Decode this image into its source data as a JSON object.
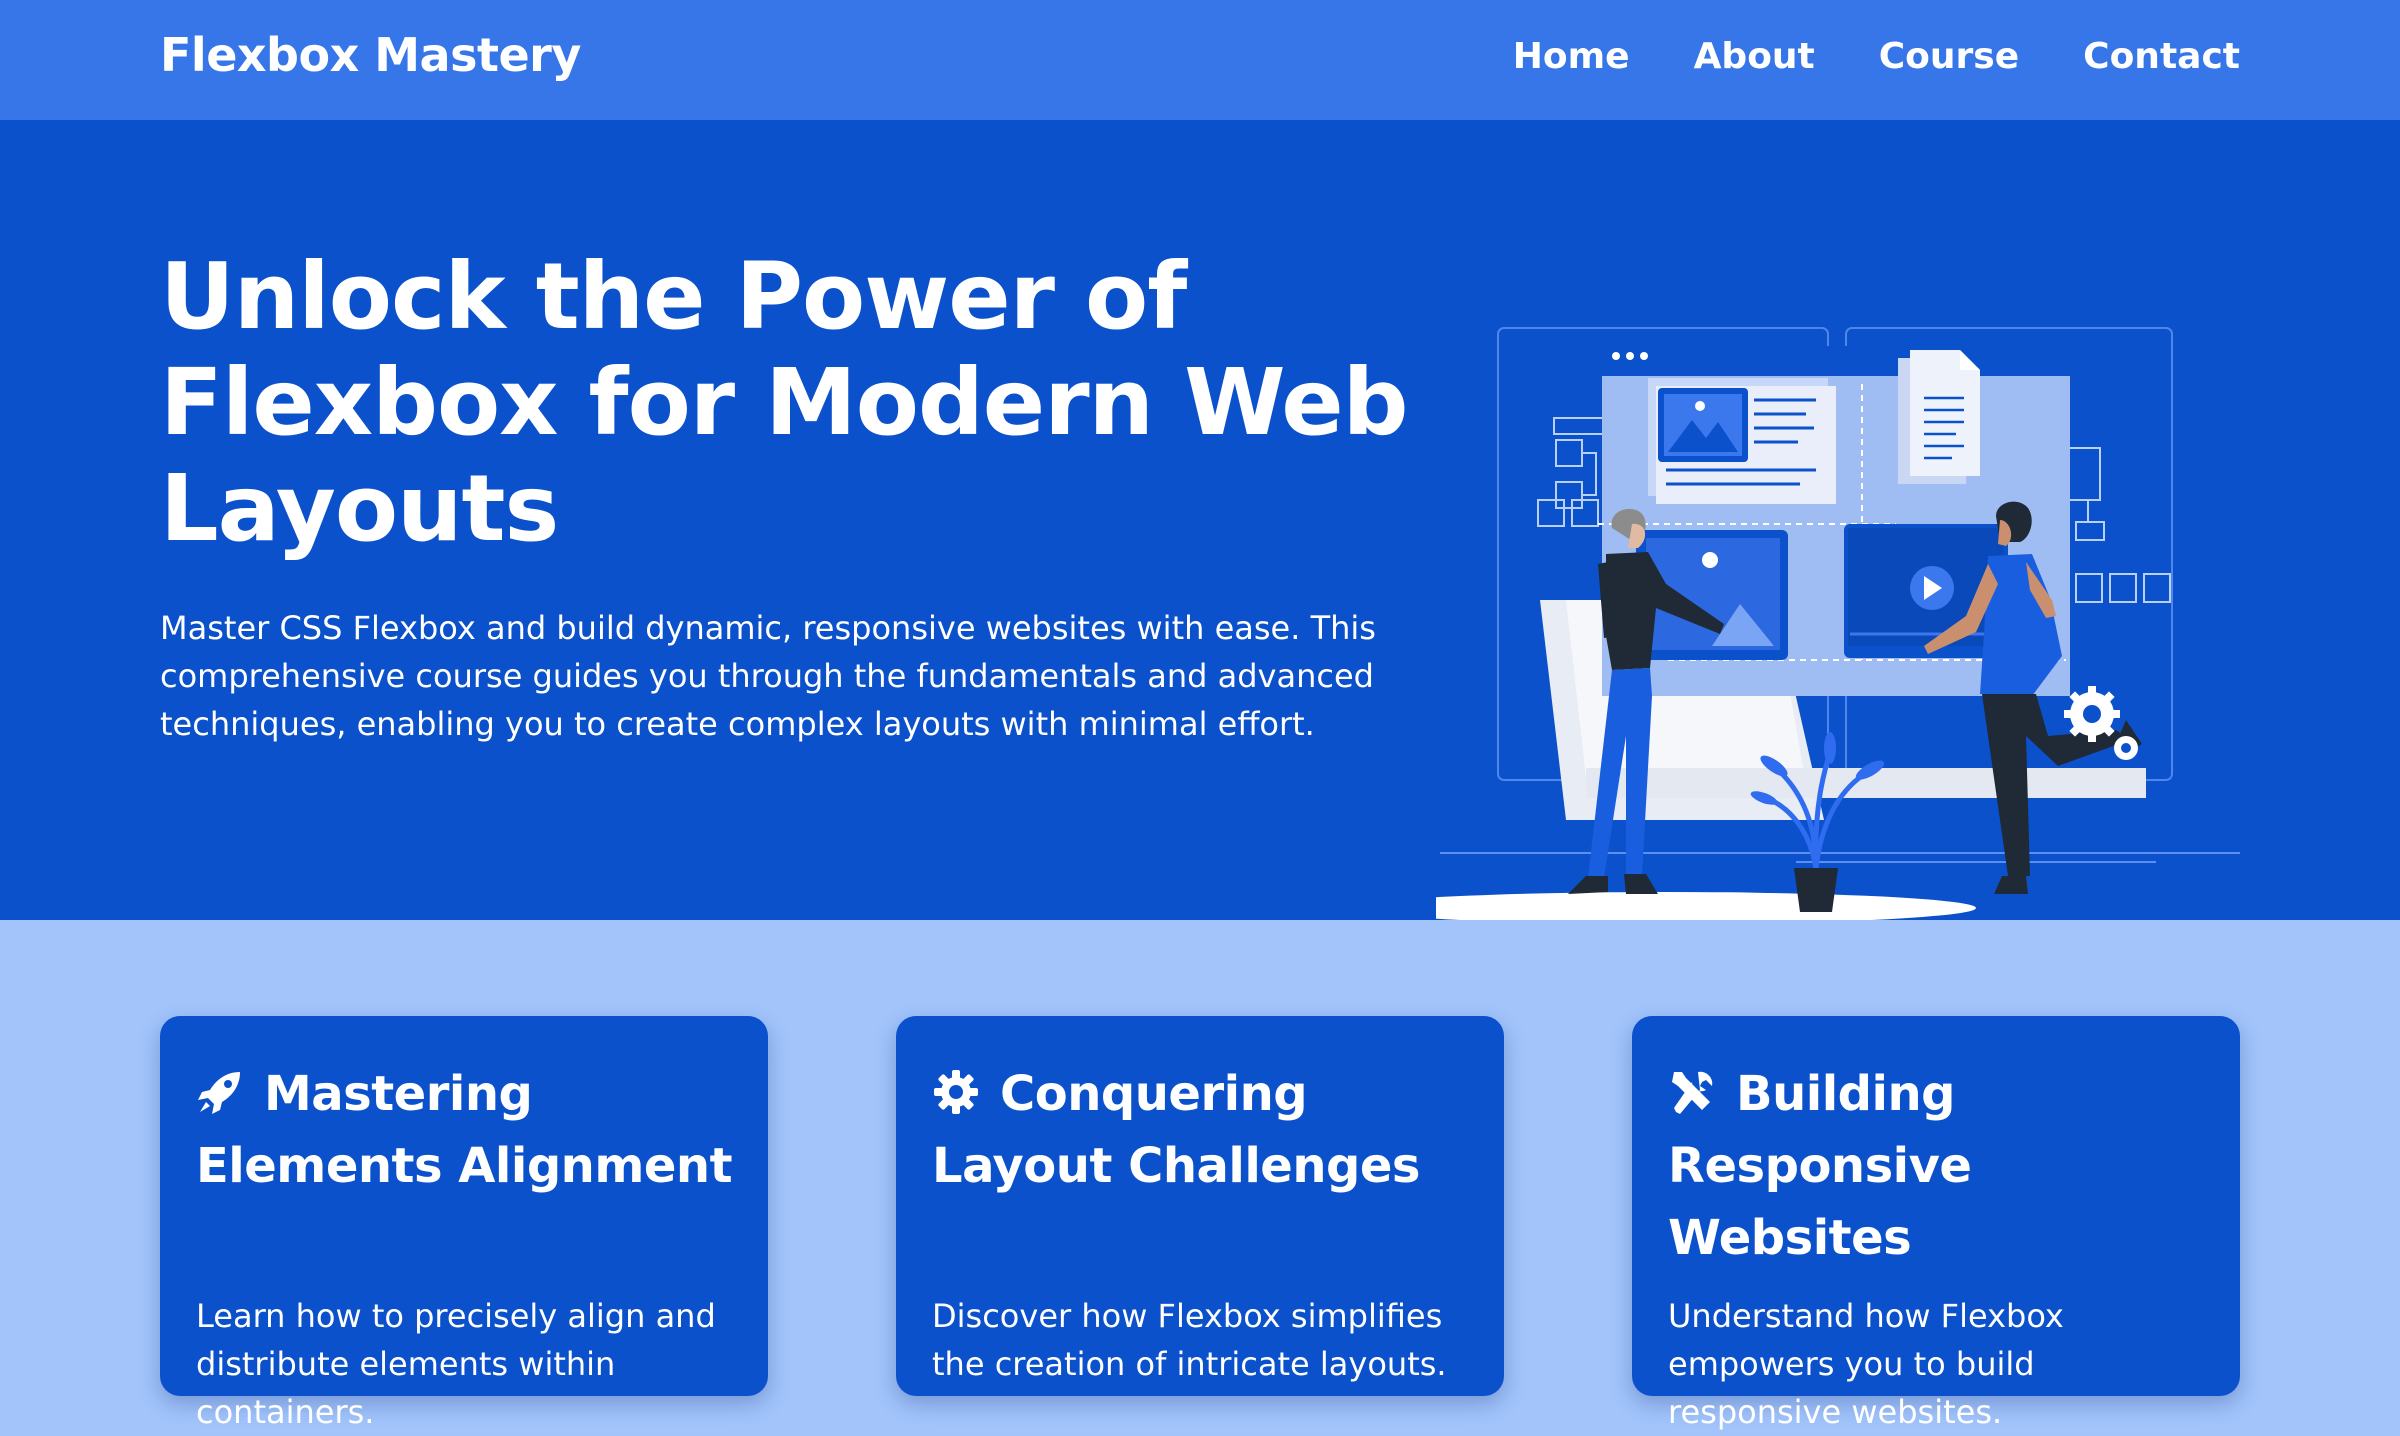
{
  "nav": {
    "brand": "Flexbox Mastery",
    "links": [
      "Home",
      "About",
      "Course",
      "Contact"
    ]
  },
  "hero": {
    "title": "Unlock the Power of Flexbox for Modern Web Layouts",
    "description": "Master CSS Flexbox and build dynamic, responsive websites with ease. This comprehensive course guides you through the fundamentals and advanced techniques, enabling you to create complex layouts with minimal effort."
  },
  "features": [
    {
      "icon": "rocket-icon",
      "title_line1": "Mastering",
      "title_line2": "Elements Alignment",
      "description": "Learn how to precisely align and distribute elements within containers."
    },
    {
      "icon": "gear-icon",
      "title_line1": "Conquering",
      "title_line2": "Layout Challenges",
      "description": "Discover how Flexbox simplifies the creation of intricate layouts."
    },
    {
      "icon": "tools-icon",
      "title_line1": "Building",
      "title_line2": "Responsive Websites",
      "description": "Understand how Flexbox empowers you to build responsive websites."
    }
  ],
  "colors": {
    "nav_bg": "#3776e8",
    "hero_bg": "#0b51cb",
    "features_bg": "#a2c4fb",
    "card_bg": "#0b51cb",
    "text": "#ffffff"
  }
}
